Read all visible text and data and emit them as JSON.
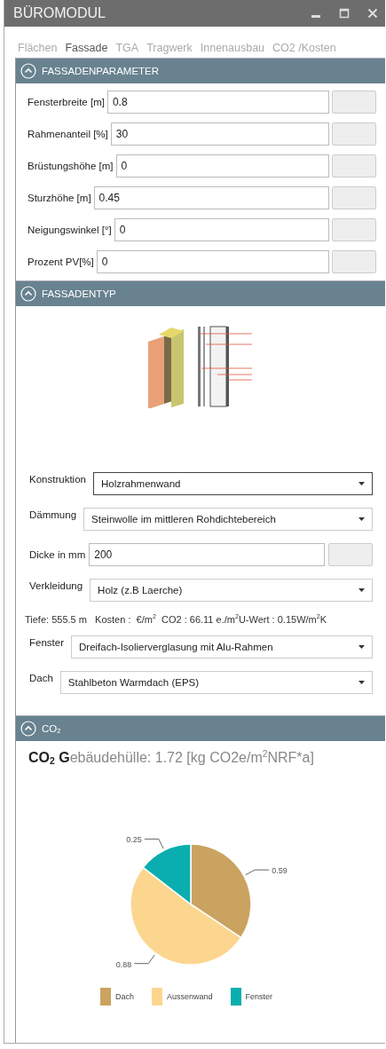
{
  "window": {
    "title": "BÜROMODUL"
  },
  "tabs": [
    {
      "label": "Flächen",
      "selected": false
    },
    {
      "label": "Fassade",
      "selected": true
    },
    {
      "label": "TGA",
      "selected": false
    },
    {
      "label": "Tragwerk",
      "selected": false
    },
    {
      "label": "Innenausbau",
      "selected": false
    },
    {
      "label": "CO2 /Kosten",
      "selected": false
    }
  ],
  "sections": [
    {
      "kind": "params",
      "title": "FASSADENPARAMETER",
      "expanded": true,
      "fields": [
        {
          "label": "Fensterbreite [m]",
          "value": "0.8"
        },
        {
          "label": "Rahmenanteil [%]",
          "value": "30"
        },
        {
          "label": "Brüstungshöhe [m]",
          "value": "0"
        },
        {
          "label": "Sturzhöhe [m]",
          "value": "0.45"
        },
        {
          "label": "Neigungswinkel [°]",
          "value": "0"
        },
        {
          "label": "Prozent PV[%]",
          "value": "0"
        }
      ]
    },
    {
      "kind": "type",
      "title": "FASSADENTYP",
      "expanded": true,
      "rows": [
        {
          "kind": "select",
          "label": "Konstruktion",
          "value": "Holzrahmenwand",
          "focused": true
        },
        {
          "kind": "select",
          "label": "Dämmung",
          "value": "Steinwolle im mittleren Rohdichtebereich",
          "focused": false
        },
        {
          "kind": "input",
          "label": "Dicke in mm",
          "value": "200"
        },
        {
          "kind": "select",
          "label": "Verkleidung",
          "value": "Holz (z.B Laerche)",
          "focused": false
        },
        {
          "kind": "info",
          "text": "Tiefe: 555.5 m   Kosten :  €/m$^{2}$  CO2 : 66.11 e./m$^{2}$U-Wert : 0.15W/m$^{2}$K"
        },
        {
          "kind": "select",
          "label": "Fenster",
          "value": "Dreifach-Isolierverglasung mit Alu-Rahmen",
          "focused": false
        },
        {
          "kind": "select",
          "label": "Dach",
          "value": "Stahlbeton Warmdach (EPS)",
          "focused": false
        }
      ]
    },
    {
      "kind": "co2",
      "title": "CO$_{2}$",
      "expanded": true,
      "heading": "**CO$_{2}$ G**ebäudehülle: 1.72  [kg CO2e/m$^{2}$NRF*a]",
      "chart_data": {
        "type": "pie",
        "categories": [
          "Dach",
          "Aussenwand",
          "Fenster"
        ],
        "colors": [
          "#c9a35f",
          "#fcd68f",
          "#0aaeae"
        ],
        "values": [
          0.59,
          0.88,
          0.25
        ],
        "data_labels": true,
        "legend": "bottom"
      }
    }
  ]
}
